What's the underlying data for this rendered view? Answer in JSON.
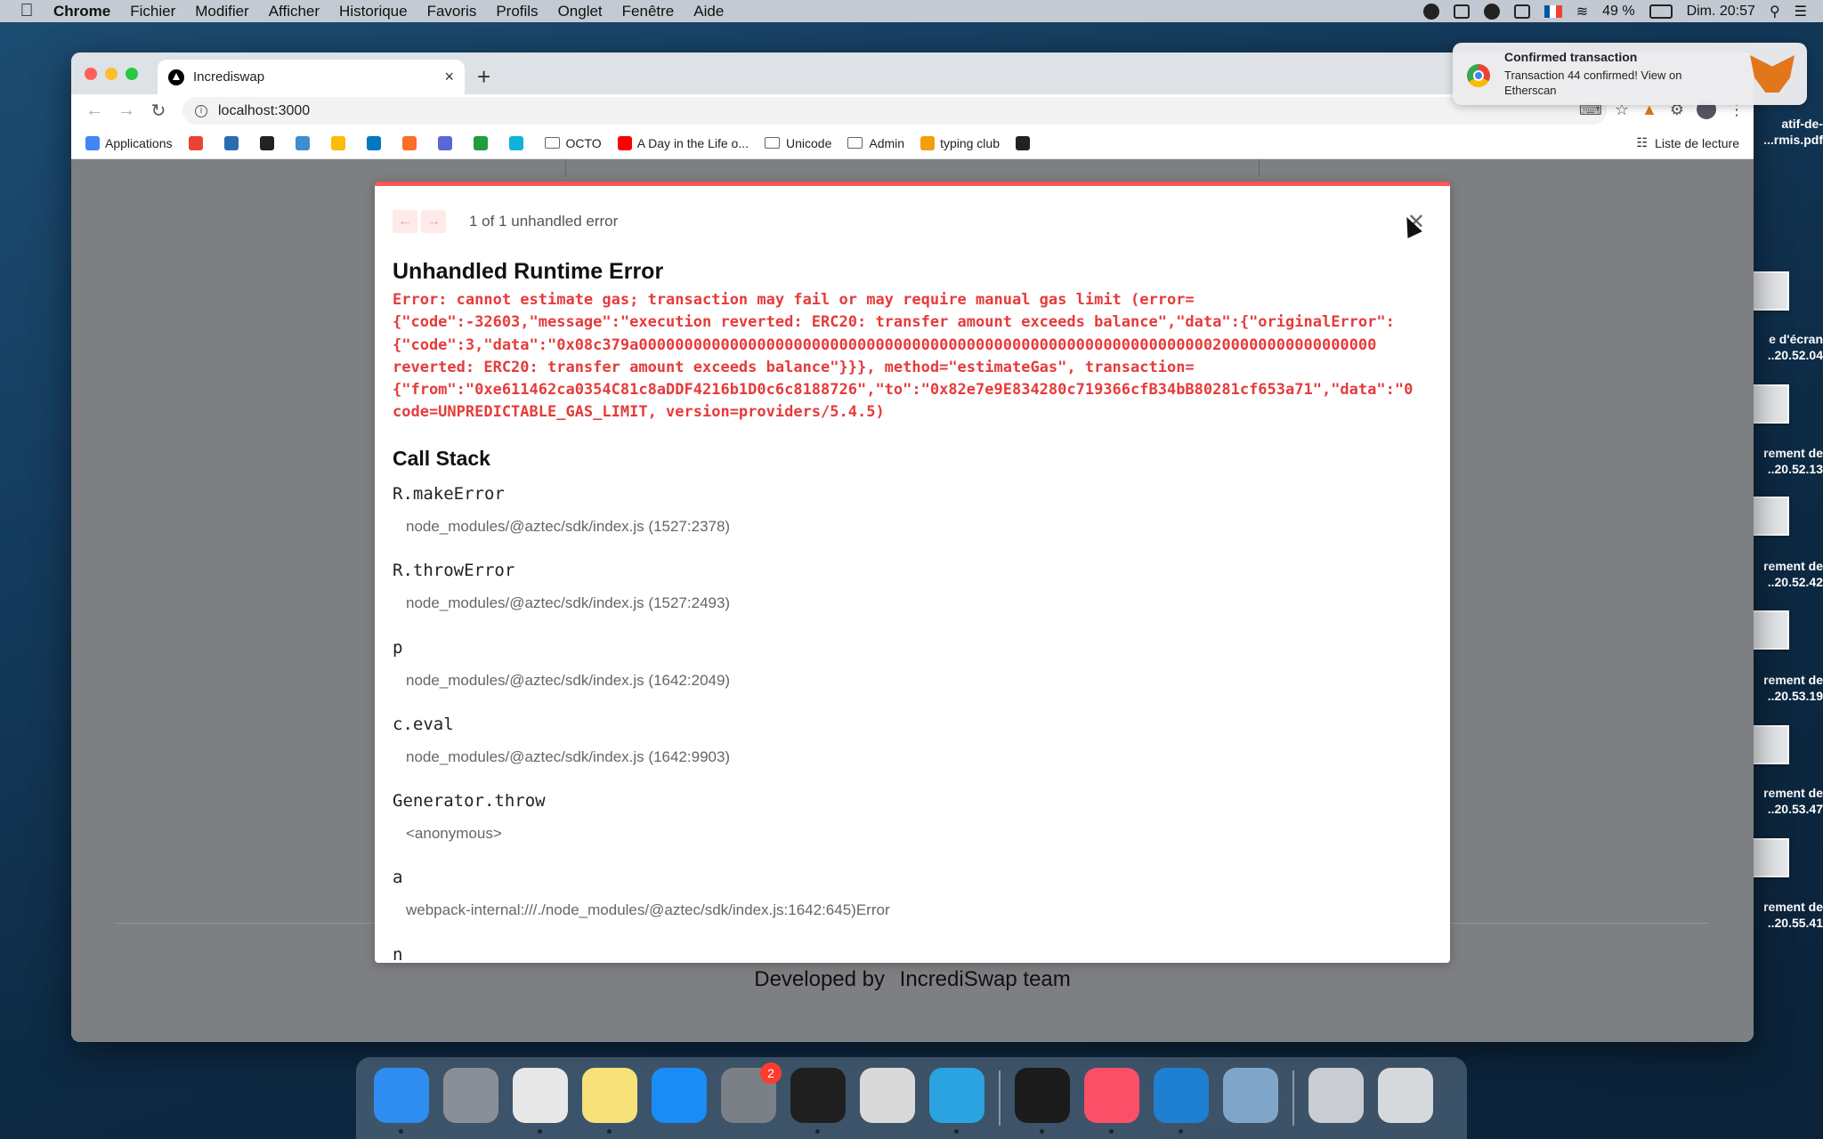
{
  "menubar": {
    "app_name": "Chrome",
    "menus": [
      "Fichier",
      "Modifier",
      "Afficher",
      "Historique",
      "Favoris",
      "Profils",
      "Onglet",
      "Fenêtre",
      "Aide"
    ],
    "battery": "49 %",
    "clock": "Dim. 20:57"
  },
  "desktop": {
    "files": [
      {
        "line1": "atif-de-",
        "line2": "...rmis.pdf"
      },
      {
        "line1": "e d'écran",
        "line2": "..20.52.04"
      },
      {
        "line1": "rement de",
        "line2": "..20.52.13"
      },
      {
        "line1": "rement de",
        "line2": "..20.52.42"
      },
      {
        "line1": "rement de",
        "line2": "..20.53.19"
      },
      {
        "line1": "rement de",
        "line2": "..20.53.47"
      },
      {
        "line1": "rement de",
        "line2": "..20.55.41"
      }
    ]
  },
  "browser": {
    "tab_title": "Incrediswap",
    "tab_close": "×",
    "new_tab": "+",
    "url": "localhost:3000",
    "bookmarks": [
      {
        "label": "Applications",
        "icon": "apps-grid-icon",
        "color": "#4285f4"
      },
      {
        "label": "",
        "icon": "gmail-icon",
        "color": "#ea4335"
      },
      {
        "label": "",
        "icon": "bank-icon",
        "color": "#2b6cb0"
      },
      {
        "label": "",
        "icon": "circle-app-icon",
        "color": "#222222"
      },
      {
        "label": "",
        "icon": "p-icon",
        "color": "#3e8ed0"
      },
      {
        "label": "",
        "icon": "drive-icon",
        "color": "#fbbc05"
      },
      {
        "label": "",
        "icon": "trello-icon",
        "color": "#0079bf"
      },
      {
        "label": "",
        "icon": "gitlab-icon",
        "color": "#fc6d26"
      },
      {
        "label": "",
        "icon": "at-icon",
        "color": "#5a67d8"
      },
      {
        "label": "",
        "icon": "sheet-icon",
        "color": "#1e9e3e"
      },
      {
        "label": "",
        "icon": "c-icon",
        "color": "#10b2d8"
      },
      {
        "label": "OCTO",
        "icon": "folder-icon",
        "color": "#666666"
      },
      {
        "label": "A Day in the Life o...",
        "icon": "youtube-icon",
        "color": "#ff0000"
      },
      {
        "label": "Unicode",
        "icon": "folder-icon",
        "color": "#666666"
      },
      {
        "label": "Admin",
        "icon": "folder-icon",
        "color": "#666666"
      },
      {
        "label": "typing club",
        "icon": "typingclub-icon",
        "color": "#f59e0b"
      },
      {
        "label": "",
        "icon": "github-icon",
        "color": "#222222"
      }
    ],
    "reading_list": "Liste de lecture"
  },
  "error_overlay": {
    "nav_prev": "←",
    "nav_next": "→",
    "count_text": "1 of 1 unhandled error",
    "close": "✕",
    "title": "Unhandled Runtime Error",
    "message": "Error: cannot estimate gas; transaction may fail or may require manual gas limit (error=\n{\"code\":-32603,\"message\":\"execution reverted: ERC20: transfer amount exceeds balance\",\"data\":{\"originalError\":\n{\"code\":3,\"data\":\"0x08c379a000000000000000000000000000000000000000000000000000000000000000200000000000000000\nreverted: ERC20: transfer amount exceeds balance\"}}}, method=\"estimateGas\", transaction=\n{\"from\":\"0xe611462ca0354C81c8aDDF4216b1D0c6c8188726\",\"to\":\"0x82e7e9E834280c719366cfB34bB80281cf653a71\",\"data\":\"0\ncode=UNPREDICTABLE_GAS_LIMIT, version=providers/5.4.5)",
    "call_stack_title": "Call Stack",
    "frames": [
      {
        "fn": "R.makeError",
        "loc": "node_modules/@aztec/sdk/index.js (1527:2378)"
      },
      {
        "fn": "R.throwError",
        "loc": "node_modules/@aztec/sdk/index.js (1527:2493)"
      },
      {
        "fn": "p",
        "loc": "node_modules/@aztec/sdk/index.js (1642:2049)"
      },
      {
        "fn": "c.eval",
        "loc": "node_modules/@aztec/sdk/index.js (1642:9903)"
      },
      {
        "fn": "Generator.throw",
        "loc": "<anonymous>"
      },
      {
        "fn": "a",
        "loc": "webpack-internal:///./node_modules/@aztec/sdk/index.js:1642:645)Error"
      },
      {
        "fn": "n",
        "loc": ""
      }
    ]
  },
  "page": {
    "footer_prefix": "Developed by",
    "footer_team": "IncrediSwap team"
  },
  "notification": {
    "title": "Confirmed transaction",
    "body": "Transaction 44 confirmed! View on Etherscan"
  },
  "dock": {
    "apps": [
      {
        "name": "finder",
        "color": "#2f8cf0",
        "running": true
      },
      {
        "name": "launchpad",
        "color": "#8a8f97",
        "running": false
      },
      {
        "name": "chrome",
        "color": "#e8e8e8",
        "running": true
      },
      {
        "name": "notes",
        "color": "#f7e27a",
        "running": true
      },
      {
        "name": "app-store",
        "color": "#1a8cf5",
        "running": false
      },
      {
        "name": "system-preferences",
        "color": "#7b7f86",
        "running": false,
        "badge": "2"
      },
      {
        "name": "terminal-alt",
        "color": "#1f1f1f",
        "running": true
      },
      {
        "name": "calculator",
        "color": "#d9d9d9",
        "running": false
      },
      {
        "name": "telegram",
        "color": "#2aa3e0",
        "running": true
      },
      {
        "name": "terminal",
        "color": "#1b1b1b",
        "running": true
      },
      {
        "name": "music",
        "color": "#fb4f67",
        "running": true
      },
      {
        "name": "vscode",
        "color": "#1f7fd1",
        "running": true
      },
      {
        "name": "preview",
        "color": "#7fa6c9",
        "running": false
      },
      {
        "name": "documents-stack",
        "color": "#c9ccd1",
        "running": false
      },
      {
        "name": "trash",
        "color": "#d6d9dc",
        "running": false
      }
    ]
  }
}
